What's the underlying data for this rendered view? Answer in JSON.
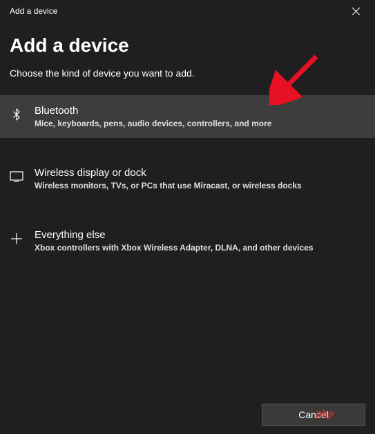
{
  "titlebar": {
    "title": "Add a device"
  },
  "heading": "Add a device",
  "subheading": "Choose the kind of device you want to add.",
  "options": [
    {
      "title": "Bluetooth",
      "desc": "Mice, keyboards, pens, audio devices, controllers, and more"
    },
    {
      "title": "Wireless display or dock",
      "desc": "Wireless monitors, TVs, or PCs that use Miracast, or wireless docks"
    },
    {
      "title": "Everything else",
      "desc": "Xbox controllers with Xbox Wireless Adapter, DLNA, and other devices"
    }
  ],
  "footer": {
    "cancel_label": "Cancel"
  },
  "watermark": "php"
}
